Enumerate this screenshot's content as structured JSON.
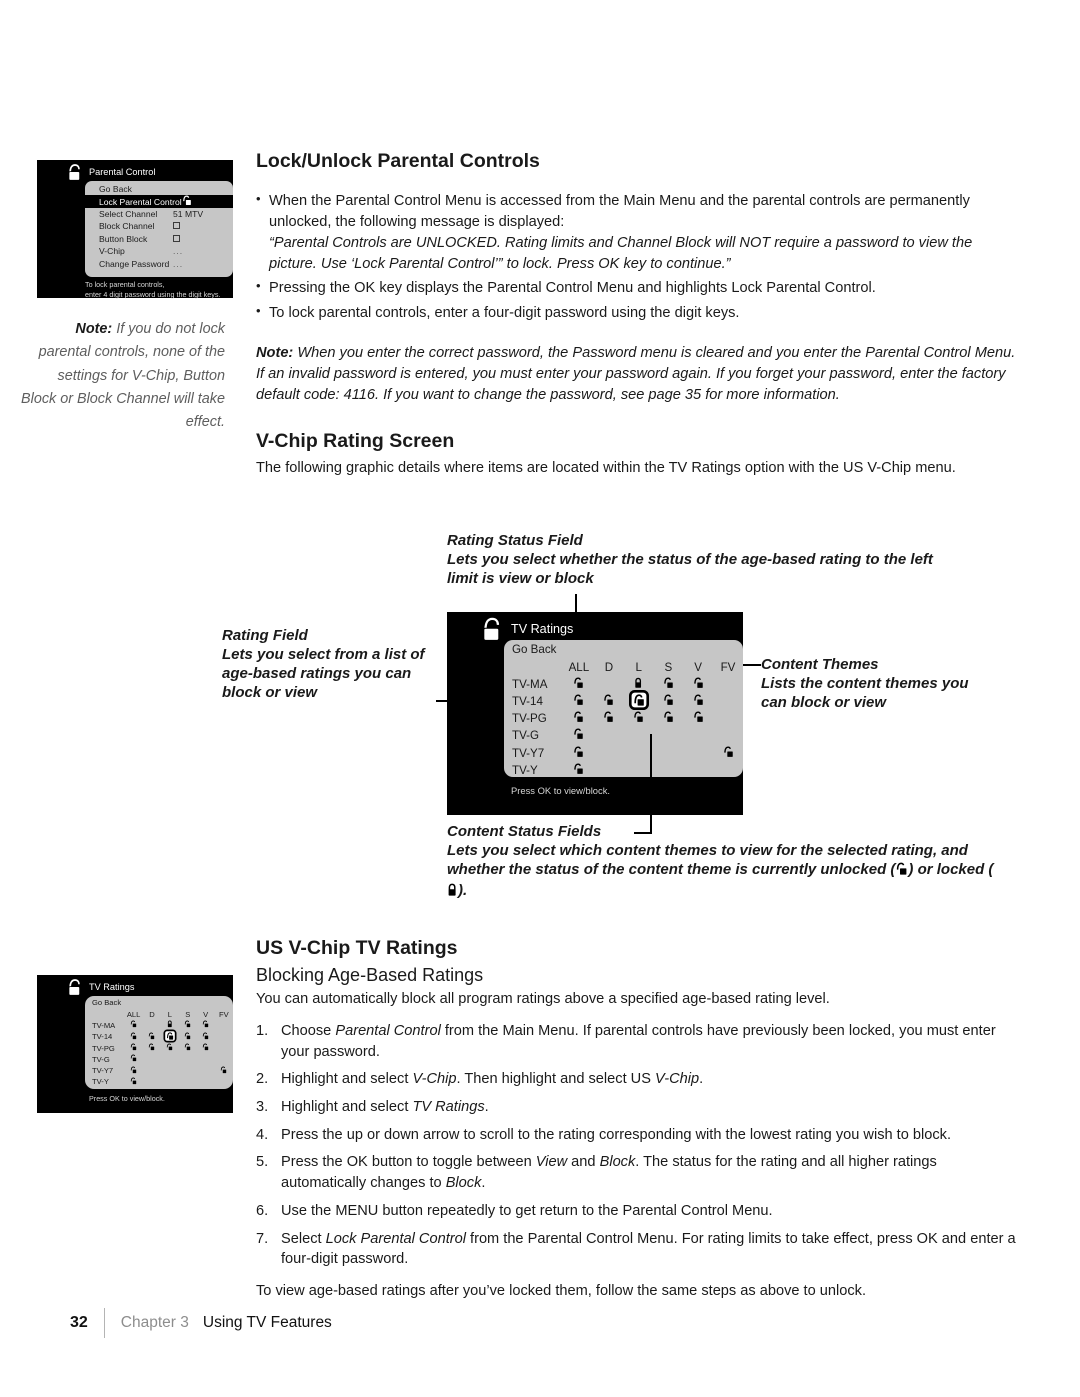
{
  "page": {
    "number": "32",
    "chapter": "Chapter 3",
    "chapter_title": "Using TV Features"
  },
  "sections": {
    "lock_unlock": {
      "heading": "Lock/Unlock Parental Controls",
      "bullets": [
        "When the Parental Control Menu is accessed from the Main Menu and the parental controls are permanently unlocked, the following message is displayed:",
        "Pressing the OK key displays the Parental Control Menu and highlights Lock Parental Control.",
        "To lock parental controls, enter a four-digit password using the digit keys."
      ],
      "quote": "“Parental Controls are UNLOCKED. Rating limits and Channel Block will NOT require a password to view the picture. Use ‘Lock Parental Control’” to lock. Press OK key to continue.”",
      "note_label": "Note:",
      "note_text": " When you enter the correct password, the Password menu is cleared and you enter the Parental Control Menu. If an invalid password is entered, you must enter your password again. If you forget your password, enter the factory default code: 4116. If you want to change the password, see page 35 for more information."
    },
    "vchip_rating_screen": {
      "heading": "V-Chip Rating Screen",
      "intro": "The following graphic details where items are located within the TV Ratings option with the US V-Chip menu."
    },
    "us_vchip": {
      "heading": "US V-Chip TV Ratings",
      "subheading": "Blocking Age-Based Ratings",
      "intro": "You can automatically block all program ratings above a specified age-based rating level.",
      "steps": [
        "Choose Parental Control from the Main Menu. If parental controls have previously been locked, you must enter your password.",
        "Highlight and select V-Chip. Then highlight and select US V-Chip.",
        "Highlight and select TV Ratings.",
        "Press the up or down arrow to scroll to the rating corresponding with the lowest rating you wish to block.",
        "Press the OK button to toggle between View and Block. The status for the rating and all higher ratings automatically changes to Block.",
        "Use the MENU button repeatedly to get return to the Parental Control Menu.",
        "Select Lock Parental Control from the Parental Control Menu. For rating limits to take effect, press OK and enter a four-digit password."
      ],
      "closing": "To view age-based ratings after you’ve locked them, follow the same steps as above to unlock."
    }
  },
  "sidenote": {
    "label": "Note:",
    "text": " If you do not lock parental controls, none of the settings for V-Chip, Button Block or Block Channel will take effect."
  },
  "parental_control_osd": {
    "title": "Parental Control",
    "footer_line1": "To lock parental controls,",
    "footer_line2": "enter 4 digit password using the digit keys.",
    "rows": [
      {
        "label": "Go Back",
        "value": "",
        "value_type": "none",
        "selected": false
      },
      {
        "label": "Lock Parental Control",
        "value": "",
        "value_type": "unlocked",
        "selected": true
      },
      {
        "label": "Select Channel",
        "value": "51 MTV",
        "value_type": "text",
        "selected": false
      },
      {
        "label": "Block Channel",
        "value": "",
        "value_type": "checkbox",
        "selected": false
      },
      {
        "label": "Button Block",
        "value": "",
        "value_type": "checkbox",
        "selected": false
      },
      {
        "label": "V-Chip",
        "value": "...",
        "value_type": "dots",
        "selected": false
      },
      {
        "label": "Change Password",
        "value": "...",
        "value_type": "dots",
        "selected": false
      }
    ]
  },
  "tv_ratings_osd": {
    "title": "TV Ratings",
    "go_back": "Go Back",
    "footer": "Press OK to view/block.",
    "columns": [
      "ALL",
      "D",
      "L",
      "S",
      "V",
      "FV"
    ],
    "rows": [
      "TV-MA",
      "TV-14",
      "TV-PG",
      "TV-G",
      "TV-Y7",
      "TV-Y"
    ],
    "cells": [
      [
        "unlocked",
        "empty",
        "locked",
        "unlocked",
        "unlocked",
        "empty"
      ],
      [
        "unlocked",
        "unlocked",
        "unlocked-selected",
        "unlocked",
        "unlocked",
        "empty"
      ],
      [
        "unlocked",
        "unlocked",
        "unlocked",
        "unlocked",
        "unlocked",
        "empty"
      ],
      [
        "unlocked",
        "empty",
        "empty",
        "empty",
        "empty",
        "empty"
      ],
      [
        "unlocked",
        "empty",
        "empty",
        "empty",
        "empty",
        "unlocked"
      ],
      [
        "unlocked",
        "empty",
        "empty",
        "empty",
        "empty",
        "empty"
      ]
    ]
  },
  "callouts": {
    "rating_status_field": {
      "title": "Rating Status Field",
      "desc": "Lets you select whether the status of the age-based rating to the left limit is view or block"
    },
    "rating_field": {
      "title": "Rating Field",
      "desc": "Lets you select from a list of age-based ratings you can block or view"
    },
    "content_themes": {
      "title": "Content Themes",
      "desc": "Lists the content themes you can block or view"
    },
    "content_status_fields": {
      "title": "Content Status Fields",
      "desc_before": "Lets you select which content themes to view for the selected rating, and whether the status of the content theme is currently unlocked (",
      "desc_middle": ") or locked (",
      "desc_after": ")."
    }
  },
  "colors": {
    "osd_background": "#000000",
    "osd_panel": "#c6c6c6",
    "selected_row": "#000000",
    "chapter_gray": "#8d8d8d",
    "sidenote_gray": "#5e5e5e"
  }
}
